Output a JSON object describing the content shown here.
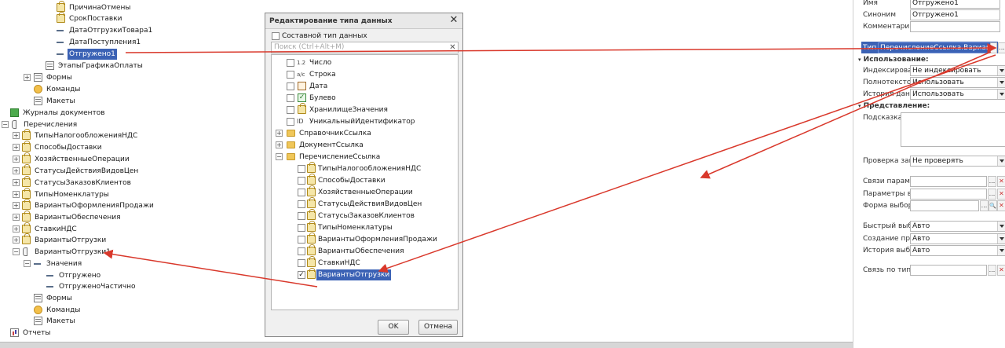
{
  "tree": {
    "items": [
      {
        "label": "ПричинаОтмены"
      },
      {
        "label": "СрокПоставки"
      },
      {
        "label": "ДатаОтгрузкиТовара1"
      },
      {
        "label": "ДатаПоступления1"
      },
      {
        "label": "Отгружено1"
      },
      {
        "label": "ЭтапыГрафикаОплаты"
      },
      {
        "label": "Формы"
      },
      {
        "label": "Команды"
      },
      {
        "label": "Макеты"
      },
      {
        "label": "Журналы документов"
      },
      {
        "label": "Перечисления"
      },
      {
        "label": "ТипыНалогообложенияНДС"
      },
      {
        "label": "СпособыДоставки"
      },
      {
        "label": "ХозяйственныеОперации"
      },
      {
        "label": "СтатусыДействияВидовЦен"
      },
      {
        "label": "СтатусыЗаказовКлиентов"
      },
      {
        "label": "ТипыНоменклатуры"
      },
      {
        "label": "ВариантыОформленияПродажи"
      },
      {
        "label": "ВариантыОбеспечения"
      },
      {
        "label": "СтавкиНДС"
      },
      {
        "label": "ВариантыОтгрузки"
      },
      {
        "label": "ВариантыОтгрузки1"
      },
      {
        "label": "Значения"
      },
      {
        "label": "Отгружено"
      },
      {
        "label": "ОтгруженоЧастично"
      },
      {
        "label": "Формы"
      },
      {
        "label": "Команды"
      },
      {
        "label": "Макеты"
      },
      {
        "label": "Отчеты"
      }
    ]
  },
  "dialog": {
    "title": "Редактирование типа данных",
    "composite_label": "Составной тип данных",
    "search_placeholder": "Поиск (Ctrl+Alt+M)",
    "primitives": [
      {
        "label": "Число",
        "icon": "1.2"
      },
      {
        "label": "Строка",
        "icon": "a/c"
      },
      {
        "label": "Дата"
      },
      {
        "label": "Булево"
      },
      {
        "label": "ХранилищеЗначения"
      },
      {
        "label": "УникальныйИдентификатор",
        "icon": "ID"
      }
    ],
    "folders": [
      {
        "label": "СправочникСсылка"
      },
      {
        "label": "ДокументСсылка"
      },
      {
        "label": "ПеречислениеСсылка"
      }
    ],
    "enum_refs": [
      {
        "label": "ТипыНалогообложенияНДС"
      },
      {
        "label": "СпособыДоставки"
      },
      {
        "label": "ХозяйственныеОперации"
      },
      {
        "label": "СтатусыДействияВидовЦен"
      },
      {
        "label": "СтатусыЗаказовКлиентов"
      },
      {
        "label": "ТипыНоменклатуры"
      },
      {
        "label": "ВариантыОформленияПродажи"
      },
      {
        "label": "ВариантыОбеспечения"
      },
      {
        "label": "СтавкиНДС"
      },
      {
        "label": "ВариантыОтгрузки"
      }
    ],
    "ok_label": "OK",
    "cancel_label": "Отмена",
    "checked_mark": "✓",
    "close_glyph": "✕"
  },
  "props": {
    "name_label": "Имя",
    "name_value": "Отгружено1",
    "synonym_label": "Синоним",
    "synonym_value": "Отгружено1",
    "comment_label": "Комментарий",
    "comment_value": "",
    "type_label": "Тип",
    "type_value": "ПеречислениеСсылка.ВариантыОт",
    "usage_section": "Использование:",
    "index_label": "Индексироват",
    "index_value": "Не индексировать",
    "fulltext_label": "Полнотекстов",
    "fulltext_value": "Использовать",
    "history_label": "История данн",
    "history_value": "Использовать",
    "presentation_section": "Представление:",
    "hint_label": "Подсказка",
    "fill_check_label": "Проверка запо",
    "fill_check_value": "Не проверять",
    "param_links_label": "Связи парамет",
    "select_params_label": "Параметры вы",
    "choice_form_label": "Форма выбора",
    "quick_choice_label": "Быстрый выбо",
    "quick_choice_value": "Авто",
    "create_on_input_label": "Создание при в",
    "create_on_input_value": "Авто",
    "choice_history_label": "История выбор",
    "choice_history_value": "Авто",
    "type_link_label": "Связь по типу",
    "ellipsis": "...",
    "clear_glyph": "✕",
    "search_glyph": "🔍"
  },
  "colors": {
    "selection": "#3b62b5",
    "arrow": "#d9382b"
  }
}
